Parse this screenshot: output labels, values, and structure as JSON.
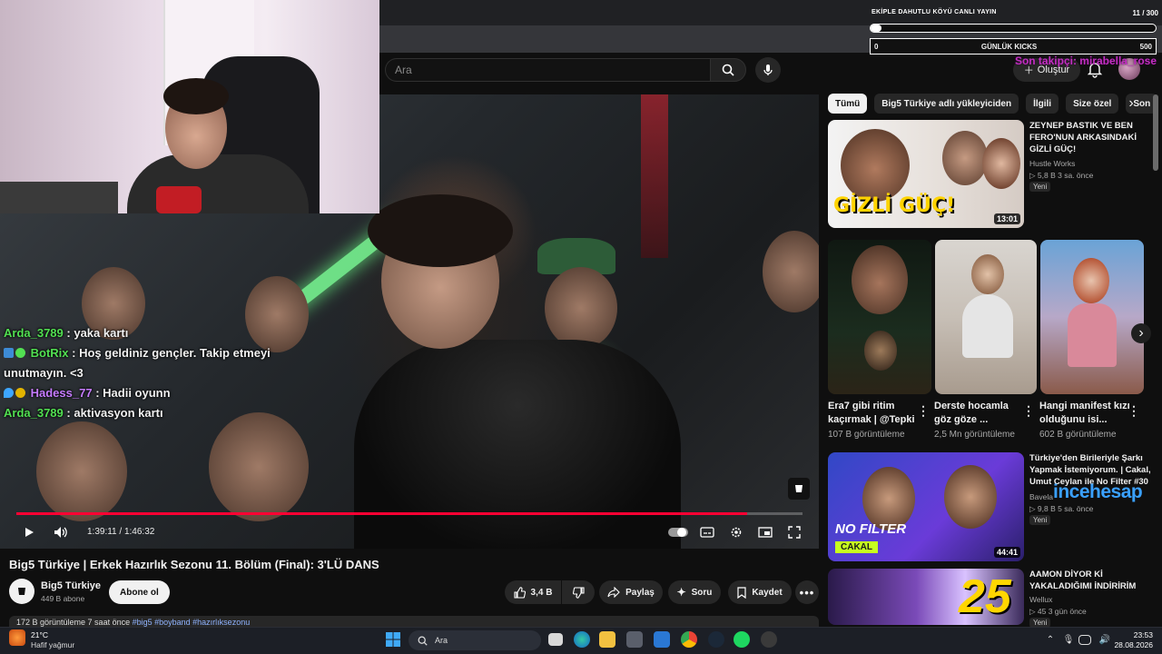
{
  "overlay": {
    "title": "EKİPLE DAHUTLU KÖYÜ CANLI YAYIN",
    "count": "11 / 300",
    "progress_fraction": 0.037,
    "box_left": "0",
    "box_center": "GÜNLÜK KICKS",
    "box_right": "500",
    "goal_text": "Son takipçi: mirabella_rose"
  },
  "search": {
    "placeholder": "Ara"
  },
  "header": {
    "create_label": "Oluştur"
  },
  "chat": [
    {
      "user": "Arda_3789",
      "color": "green",
      "badges": [],
      "message": ": yaka kartı"
    },
    {
      "user": "BotRix",
      "color": "green",
      "badges": [
        "bot",
        "verified"
      ],
      "message": ": Hoş geldiniz gençler. Takip etmeyi unutmayın. <3"
    },
    {
      "user": "Hadess_77",
      "color": "purple",
      "badges": [
        "drop",
        "gold"
      ],
      "message": ": Hadii oyunn"
    },
    {
      "user": "Arda_3789",
      "color": "green",
      "badges": [],
      "message": ": aktivasyon kartı"
    }
  ],
  "player": {
    "time": "1:39:11 / 1:46:32",
    "progress_fraction": 0.93
  },
  "video": {
    "title": "Big5 Türkiye | Erkek Hazırlık Sezonu 11. Bölüm (Final): 3'LÜ DANS",
    "channel": "Big5 Türkiye",
    "subs": "449 B abone",
    "subscribe_label": "Abone ol",
    "likes": "3,4 B",
    "share_label": "Paylaş",
    "ask_label": "Soru",
    "save_label": "Kaydet",
    "desc_meta": "172 B görüntüleme  7 saat önce",
    "desc_tags": "#big5 #boyband #hazırlıksezonu"
  },
  "chips": [
    "Tümü",
    "Big5 Türkiye adlı yükleyiciden",
    "İlgili",
    "Size özel",
    "Son"
  ],
  "recs": [
    {
      "title": "ZEYNEP BASTIK VE BEN FERO'NUN ARKASINDAKİ GİZLİ GÜÇ!",
      "channel": "Hustle Works",
      "meta": "▷ 5,8 B   3 sa. önce",
      "badge": "Yeni",
      "duration": "13:01",
      "thumb_text": "GİZLİ GÜÇ!"
    },
    {
      "title": "Türkiye'den Birileriyle Şarkı Yapmak İstemiyorum. | Cakal, Umut Ceylan ile No Filter #30",
      "channel": "Bavela",
      "meta": "▷ 9,8 B   5 sa. önce",
      "badge": "Yeni",
      "duration": "44:41",
      "thumb_text": "NO FILTER",
      "thumb_sub": "CAKAL"
    },
    {
      "title": "AAMON DİYOR Kİ YAKALADIĞIMI İNDİRİRİM",
      "channel": "Wellux",
      "meta": "▷ 45   3 gün önce",
      "badge": "Yeni",
      "thumb_text": "25"
    }
  ],
  "shorts": [
    {
      "title": "Era7 gibi ritim kaçırmak | @Tepki",
      "views": "107 B görüntüleme"
    },
    {
      "title": "Derste hocamla göz göze ...",
      "views": "2,5 Mn görüntüleme"
    },
    {
      "title": "Hangi manifest kızı olduğunu isi...",
      "views": "602 B görüntüleme"
    }
  ],
  "watermark_text": "incehesap",
  "taskbar": {
    "temp": "21°C",
    "weather": "Hafif yağmur",
    "search_label": "Ara",
    "time": "23:53",
    "date": "28.08.2026"
  },
  "colors": {
    "accent": "#ff0033",
    "chat_green": "#52e052",
    "chat_purple": "#c67cff",
    "goal_magenta": "#c22ec2"
  }
}
